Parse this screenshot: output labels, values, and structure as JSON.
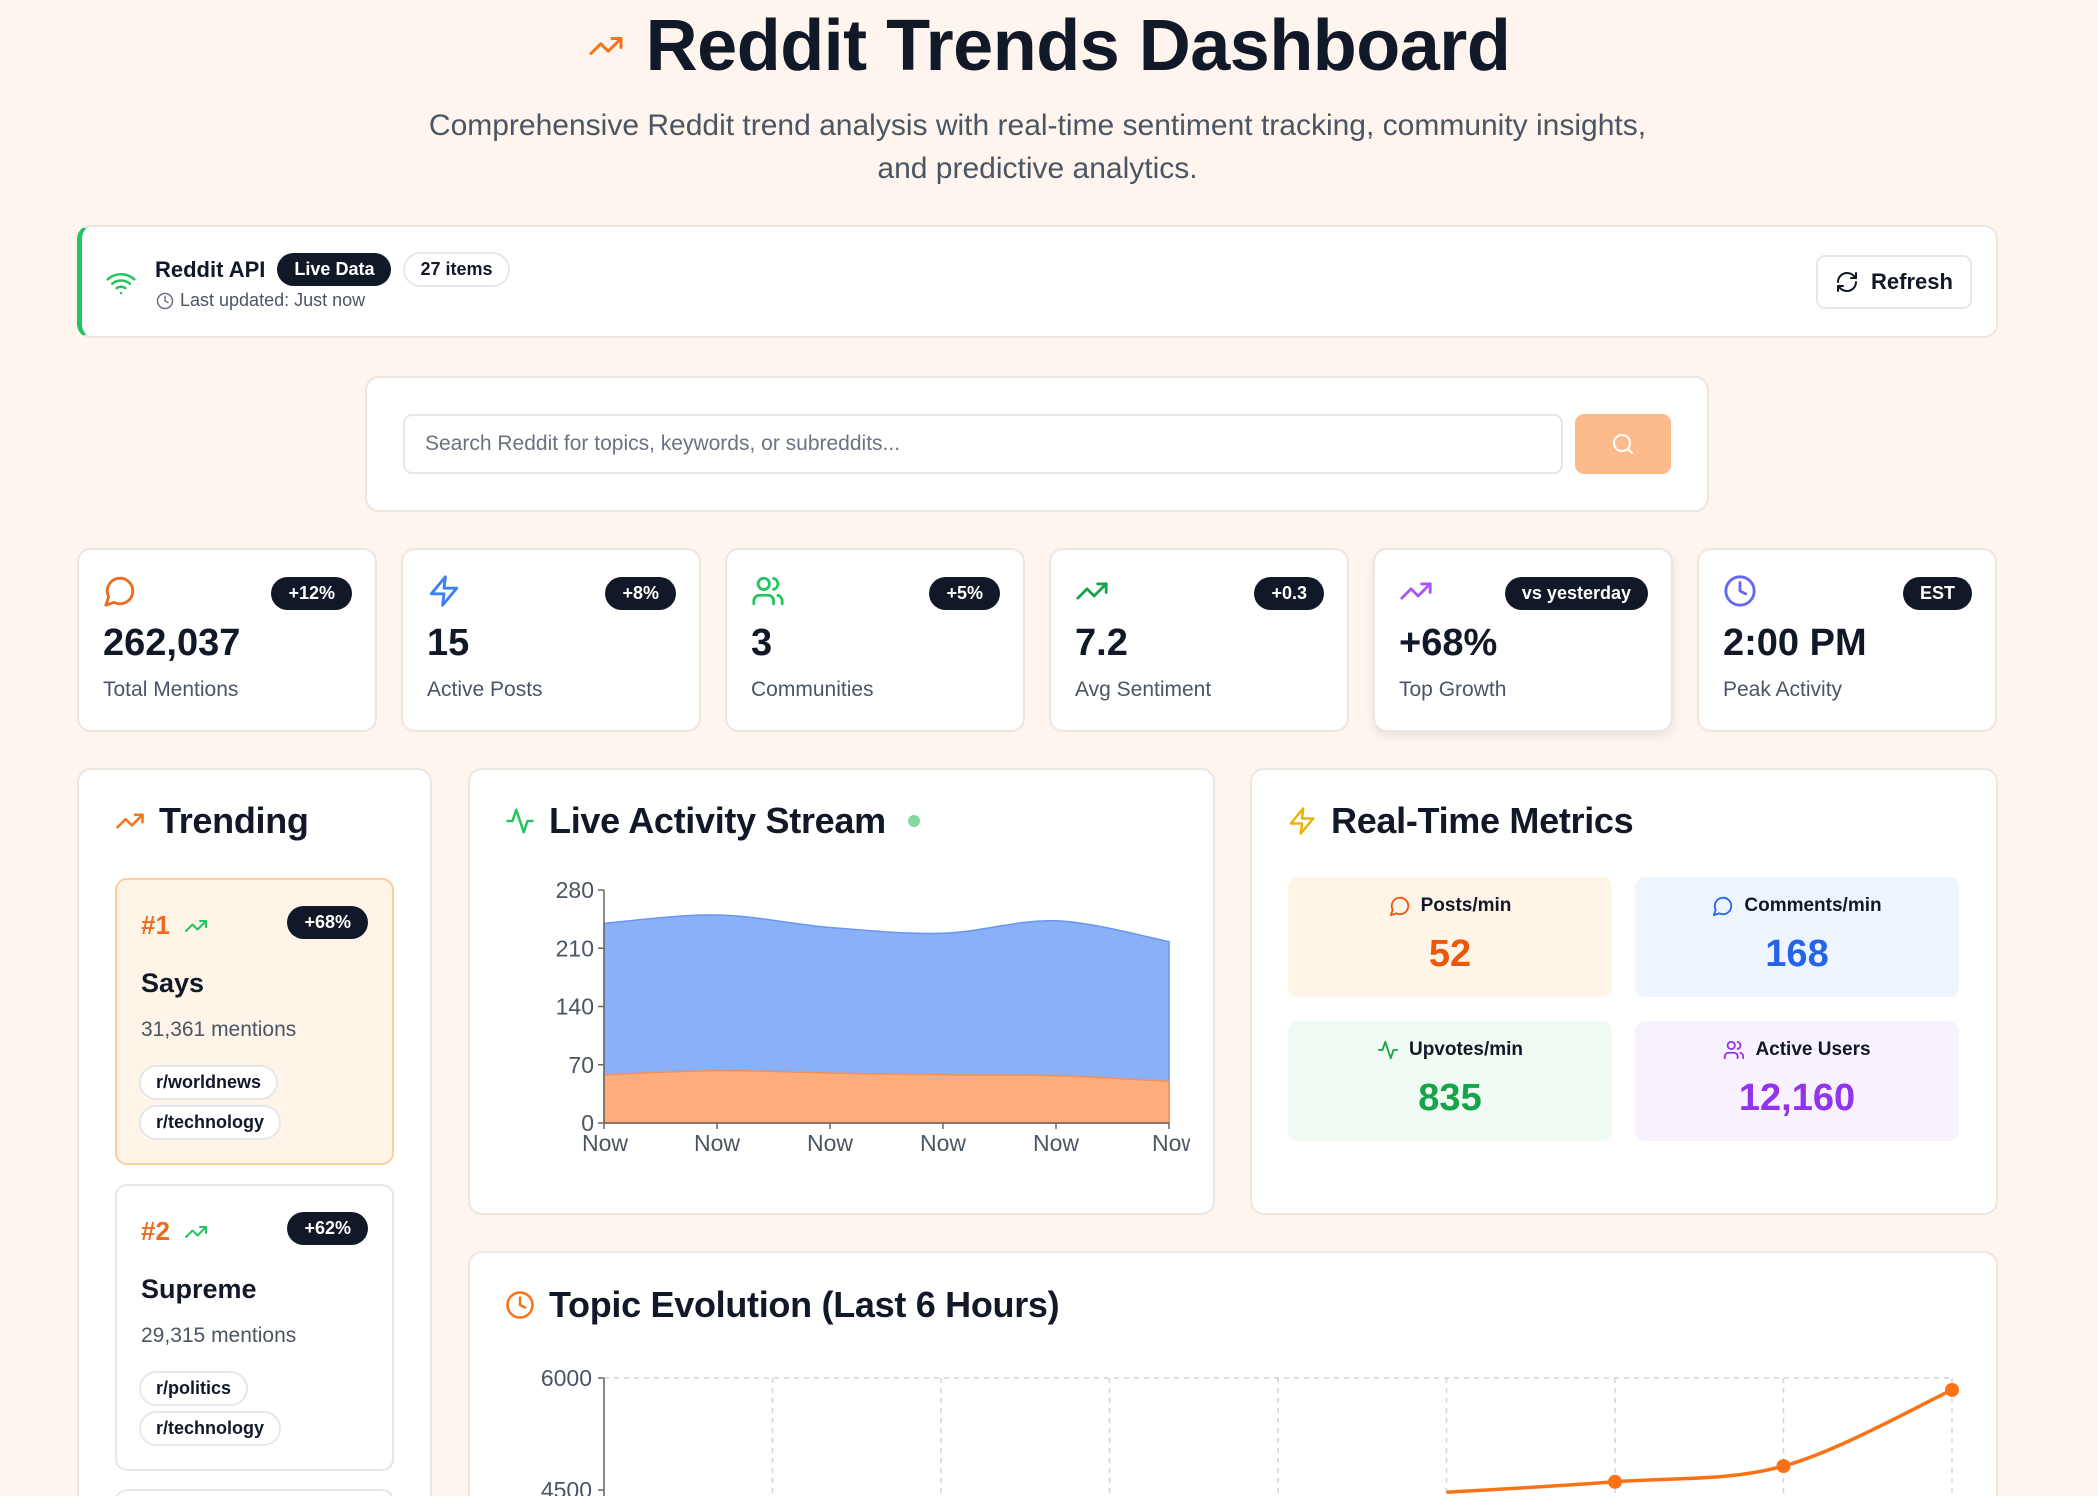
{
  "header": {
    "title": "Reddit Trends Dashboard",
    "subtitle": "Comprehensive Reddit trend analysis with real-time sentiment tracking, community insights, and predictive analytics."
  },
  "status": {
    "source": "Reddit API",
    "live_badge": "Live Data",
    "items_badge": "27 items",
    "last_updated": "Last updated: Just now",
    "refresh_label": "Refresh"
  },
  "search": {
    "placeholder": "Search Reddit for topics, keywords, or subreddits..."
  },
  "stats": [
    {
      "icon": "message-circle-icon",
      "badge": "+12%",
      "value": "262,037",
      "label": "Total Mentions",
      "color": "#ea6c1c"
    },
    {
      "icon": "zap-icon",
      "badge": "+8%",
      "value": "15",
      "label": "Active Posts",
      "color": "#3b82f6"
    },
    {
      "icon": "users-icon",
      "badge": "+5%",
      "value": "3",
      "label": "Communities",
      "color": "#22c55e"
    },
    {
      "icon": "trending-up-icon",
      "badge": "+0.3",
      "value": "7.2",
      "label": "Avg Sentiment",
      "color": "#16a34a"
    },
    {
      "icon": "trending-up-icon",
      "badge": "vs yesterday",
      "value": "+68%",
      "label": "Top Growth",
      "color": "#a855f7"
    },
    {
      "icon": "clock-icon",
      "badge": "EST",
      "value": "2:00 PM",
      "label": "Peak Activity",
      "color": "#6366f1"
    }
  ],
  "trending": {
    "title": "Trending",
    "items": [
      {
        "rank": "#1",
        "growth": "+68%",
        "name": "Says",
        "mentions": "31,361 mentions",
        "subs": [
          "r/worldnews",
          "r/technology"
        ]
      },
      {
        "rank": "#2",
        "growth": "+62%",
        "name": "Supreme",
        "mentions": "29,315 mentions",
        "subs": [
          "r/politics",
          "r/technology"
        ]
      }
    ]
  },
  "live": {
    "title": "Live Activity Stream"
  },
  "metrics": {
    "title": "Real-Time Metrics",
    "cards": [
      {
        "label": "Posts/min",
        "value": "52",
        "icon": "message-circle-icon"
      },
      {
        "label": "Comments/min",
        "value": "168",
        "icon": "message-circle-icon"
      },
      {
        "label": "Upvotes/min",
        "value": "835",
        "icon": "activity-icon"
      },
      {
        "label": "Active Users",
        "value": "12,160",
        "icon": "users-icon"
      }
    ],
    "colors": {
      "orange": "#ea580c",
      "blue": "#2563eb",
      "green": "#16a34a",
      "purple": "#9333ea"
    }
  },
  "topic": {
    "title": "Topic Evolution (Last 6 Hours)"
  },
  "chart_data": [
    {
      "type": "area",
      "x": [
        "Now",
        "Now",
        "Now",
        "Now",
        "Now",
        "Now"
      ],
      "series": [
        {
          "values": [
            58,
            63,
            60,
            58,
            57,
            50
          ],
          "color": "#fdad7c"
        },
        {
          "values": [
            240,
            250,
            235,
            228,
            243,
            218
          ],
          "color": "#8ab0f8"
        }
      ],
      "yticks": [
        0,
        70,
        140,
        210,
        280
      ],
      "ylim": [
        0,
        280
      ],
      "grid": false
    },
    {
      "type": "line",
      "y_ticks_visible": [
        "6000",
        "4500"
      ],
      "ylim": [
        4500,
        6000
      ],
      "points_visible": [
        4610,
        4820,
        5840
      ],
      "color": "#f97316",
      "grid": true
    }
  ]
}
